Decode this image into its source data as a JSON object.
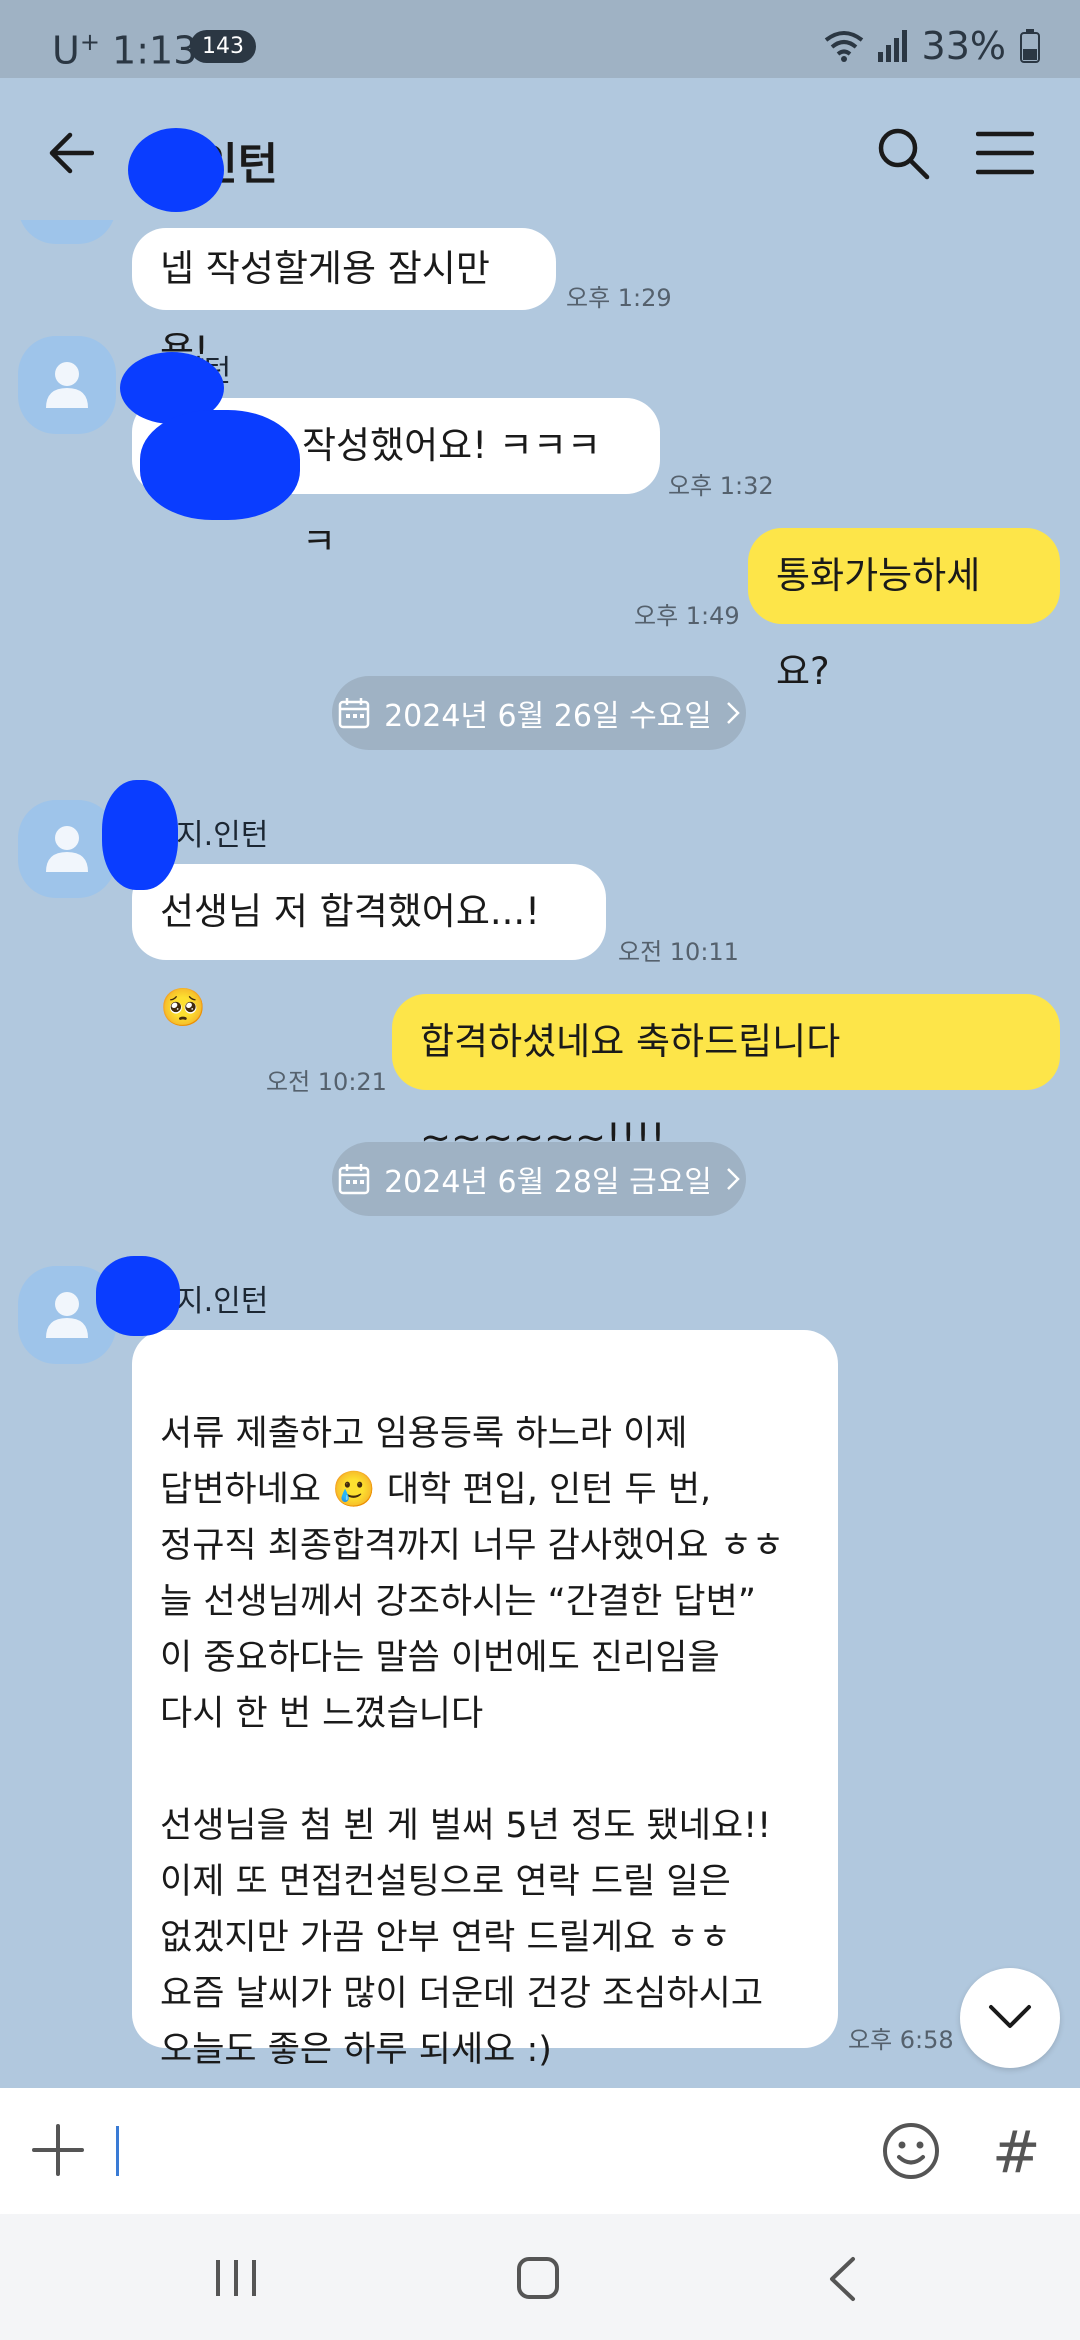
{
  "status": {
    "carrier": "U",
    "carrier_sup": "+",
    "time": "1:13",
    "badge": "143",
    "battery": "33%"
  },
  "header": {
    "title": "지.인턴",
    "back_icon": "arrow-left-icon",
    "search_icon": "search-icon",
    "menu_icon": "hamburger-menu-icon"
  },
  "messages": [
    {
      "side": "them",
      "text": "넵 작성할게용 잠시만용!",
      "time": "오후 1:29"
    },
    {
      "side": "them",
      "sender": "인턴",
      "text": "작성했어요! ㅋㅋㅋㅋ",
      "time": "오후 1:32"
    },
    {
      "side": "me",
      "text": "통화가능하세요?",
      "time": "오후 1:49"
    },
    {
      "side": "date",
      "text": "2024년 6월 26일 수요일"
    },
    {
      "side": "them",
      "sender": "지.인턴",
      "text": "선생님 저 합격했어요...! 🥺",
      "time": "오전 10:11"
    },
    {
      "side": "me",
      "text": "합격하셨네요  축하드립니다 ~~~~~~!!!!",
      "time": "오전 10:21"
    },
    {
      "side": "date",
      "text": "2024년 6월 28일 금요일"
    },
    {
      "side": "them",
      "sender": "지.인턴",
      "text": "서류 제출하고 임용등록 하느라 이제\n답변하네요 🥲 대학 편입, 인턴 두 번,\n정규직 최종합격까지 너무 감사했어요 ㅎㅎ\n늘 선생님께서 강조하시는 “간결한 답변”\n이 중요하다는 말씀 이번에도 진리임을\n다시 한 번 느꼈습니다\n\n선생님을 첨 뵌 게 벌써 5년 정도 됐네요!!\n이제 또 면접컨설팅으로 연락 드릴 일은\n없겠지만 가끔 안부 연락 드릴게요 ㅎㅎ\n요즘 날씨가 많이 더운데 건강 조심하시고\n오늘도 좋은 하루 되세요 :)",
      "time": "오후 6:58"
    }
  ],
  "input": {
    "plus_icon": "plus-icon",
    "emoji_icon": "emoji-icon",
    "hash_label": "#"
  },
  "navbar": {
    "recent_icon": "recent-apps-icon",
    "home_icon": "home-icon",
    "back_icon": "nav-back-icon"
  }
}
